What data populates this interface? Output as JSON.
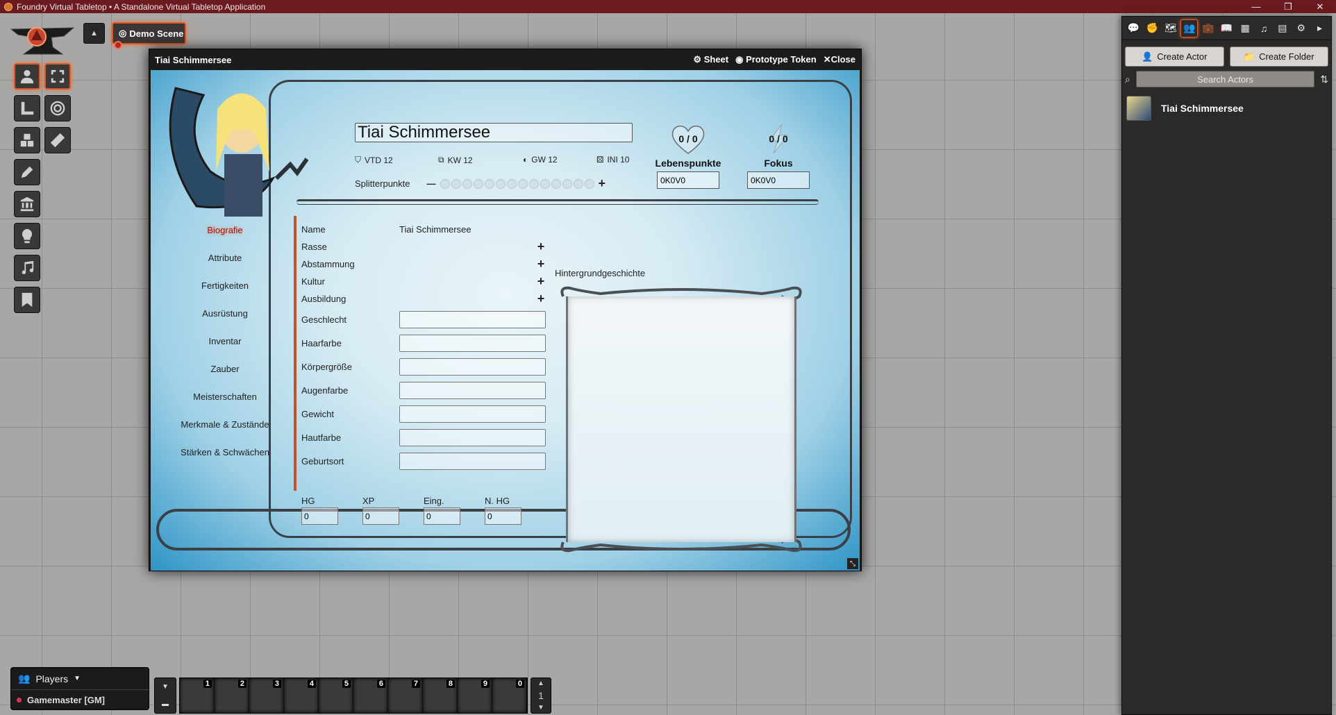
{
  "os": {
    "title": "Foundry Virtual Tabletop • A Standalone Virtual Tabletop Application",
    "controls": [
      "—",
      "❐",
      "✕"
    ]
  },
  "scene": {
    "toggle_icon": "▲",
    "name": "Demo Scene"
  },
  "sheet_window": {
    "title": "Tiai Schimmersee",
    "controls": {
      "sheet": "Sheet",
      "prototype": "Prototype Token",
      "close": "Close"
    }
  },
  "actor": {
    "name": "Tiai Schimmersee",
    "stats": [
      {
        "icon": "shield-icon",
        "glyph": "⛉",
        "label": "VTD 12"
      },
      {
        "icon": "strength-icon",
        "glyph": "⧉",
        "label": "KW 12"
      },
      {
        "icon": "brain-icon",
        "glyph": "◐",
        "label": "GW 12"
      },
      {
        "icon": "dice-icon",
        "glyph": "⚄",
        "label": "INI 10"
      }
    ],
    "splitter": {
      "label": "Splitterpunkte",
      "minus": "—",
      "plus": "+",
      "dot_count": 14
    },
    "lebenspunkte": {
      "value": "0 / 0",
      "label": "Lebenspunkte",
      "field": "0K0V0"
    },
    "fokus": {
      "value": "0 / 0",
      "label": "Fokus",
      "field": "0K0V0"
    }
  },
  "nav_tabs": [
    {
      "label": "Biografie",
      "active": true
    },
    {
      "label": "Attribute",
      "active": false
    },
    {
      "label": "Fertigkeiten",
      "active": false
    },
    {
      "label": "Ausrüstung",
      "active": false
    },
    {
      "label": "Inventar",
      "active": false
    },
    {
      "label": "Zauber",
      "active": false
    },
    {
      "label": "Meisterschaften",
      "active": false
    },
    {
      "label": "Merkmale & Zustände",
      "active": false
    },
    {
      "label": "Stärken & Schwächen",
      "active": false
    }
  ],
  "biography": {
    "name_label": "Name",
    "name_value": "Tiai Schimmersee",
    "rasse": "Rasse",
    "abstammung": "Abstammung",
    "kultur": "Kultur",
    "ausbildung": "Ausbildung",
    "plus": "+",
    "fields": [
      "Geschlecht",
      "Haarfarbe",
      "Körpergröße",
      "Augenfarbe",
      "Gewicht",
      "Hautfarbe",
      "Geburtsort"
    ],
    "hg": {
      "label": "HG",
      "value": "0"
    },
    "xp": {
      "label": "XP",
      "value": "0"
    },
    "eing": {
      "label": "Eing.",
      "value": "0"
    },
    "nhg": {
      "label": "N. HG",
      "value": "0"
    },
    "story_title": "Hintergrundgeschichte"
  },
  "sidebar": {
    "tabs": [
      {
        "name": "chat-icon",
        "glyph": "💬"
      },
      {
        "name": "combat-icon",
        "glyph": "✊"
      },
      {
        "name": "scenes-icon",
        "glyph": "🗺"
      },
      {
        "name": "actors-icon",
        "glyph": "👥",
        "active": true
      },
      {
        "name": "items-icon",
        "glyph": "💼"
      },
      {
        "name": "journal-icon",
        "glyph": "📖"
      },
      {
        "name": "tables-icon",
        "glyph": "▦"
      },
      {
        "name": "playlists-icon",
        "glyph": "♫"
      },
      {
        "name": "compendium-icon",
        "glyph": "▤"
      },
      {
        "name": "settings-icon",
        "glyph": "⚙"
      },
      {
        "name": "collapse-icon",
        "glyph": "▸"
      }
    ],
    "create_actor": "Create Actor",
    "create_folder": "Create Folder",
    "search_placeholder": "Search Actors",
    "actors": [
      {
        "name": "Tiai Schimmersee"
      }
    ]
  },
  "players": {
    "title": "Players",
    "user": "Gamemaster [GM]"
  },
  "hotbar": {
    "slots": [
      "1",
      "2",
      "3",
      "4",
      "5",
      "6",
      "7",
      "8",
      "9",
      "0"
    ],
    "page": "1"
  }
}
